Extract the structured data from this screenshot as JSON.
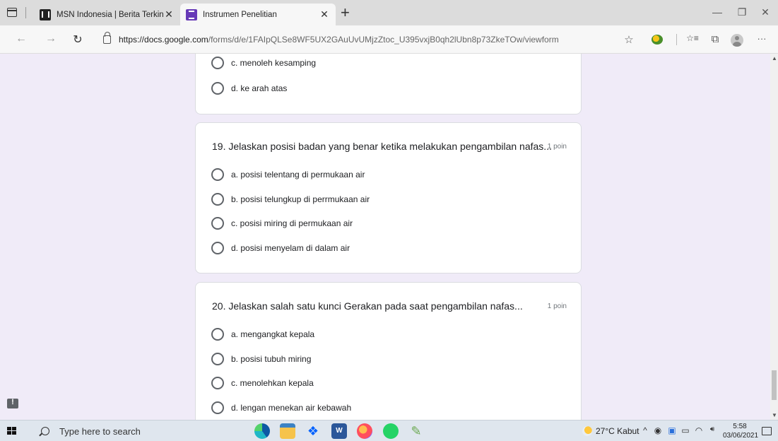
{
  "browser": {
    "tabs": [
      {
        "title": "MSN Indonesia | Berita Terkini H",
        "favicon": "msn-icon",
        "close": "✕"
      },
      {
        "title": "Instrumen Penelitian",
        "favicon": "google-forms-icon",
        "close": "✕"
      }
    ],
    "new_tab": "+",
    "window_controls": {
      "minimize": "—",
      "restore": "❐",
      "close": "✕"
    },
    "nav": {
      "back": "←",
      "forward": "→",
      "reload": "↻"
    },
    "url_host": "https://docs.google.com",
    "url_path": "/forms/d/e/1FAIpQLSe8WF5UX2GAuUvUMjzZtoc_U395vxjB0qh2lUbn8p73ZkeTOw/viewform",
    "toolbar": {
      "favorite": "☆",
      "favorites": "☆≡",
      "collections": "⧉",
      "more": "···"
    }
  },
  "form": {
    "prev_question": {
      "options": [
        "c. menoleh kesamping",
        "d. ke arah atas"
      ]
    },
    "questions": [
      {
        "title": "19. Jelaskan posisi badan yang benar ketika melakukan pengambilan nafas...",
        "points": "1 poin",
        "options": [
          "a. posisi telentang di permukaan air",
          "b. posisi telungkup di perrmukaan air",
          "c. posisi miring di permukaan air",
          "d. posisi menyelam di dalam air"
        ]
      },
      {
        "title": "20. Jelaskan salah satu kunci Gerakan pada saat pengambilan nafas...",
        "points": "1 poin",
        "options": [
          "a. mengangkat kepala",
          "b. posisi tubuh miring",
          "c. menolehkan kepala",
          "d. lengan menekan air kebawah"
        ]
      }
    ]
  },
  "taskbar": {
    "search_placeholder": "Type here to search",
    "apps": [
      "edge-icon",
      "file-explorer-icon",
      "dropbox-icon",
      "word-icon",
      "firefox-icon",
      "whatsapp-icon",
      "paint-icon"
    ],
    "weather": "27°C  Kabut",
    "tray": {
      "chevron": "^",
      "volume": "🔊︎"
    },
    "time": "5:58",
    "date": "03/06/2021"
  }
}
